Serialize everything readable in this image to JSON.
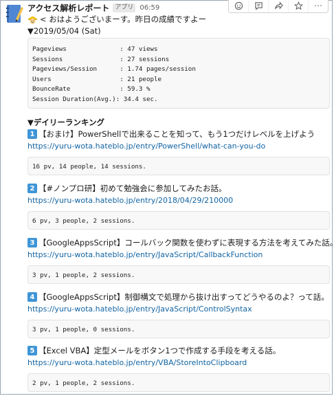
{
  "bot": {
    "name": "アクセス解析レポート",
    "badge": "アプリ",
    "time": "06:59"
  },
  "toolbar": {
    "icons": [
      "emoji-reaction-icon",
      "reply-thread-icon",
      "share-icon",
      "star-icon",
      "more-icon"
    ],
    "more_label": "⋯"
  },
  "greeting": "< おはようございまーす。昨日の成績ですよー",
  "date_line": "▼2019/05/04 (Sat)",
  "stats": [
    "Pageviews              : 47 views",
    "Sessions               : 27 sessions",
    "Pageviews/Session      : 1.74 pages/session",
    "Users                  : 21 people",
    "BounceRate             : 59.3 %",
    "Session Duration(Avg.): 34.4 sec."
  ],
  "ranking_title": "▼デイリーランキング",
  "ranking": [
    {
      "num": "1",
      "title": "【おまけ】PowerShellで出来ることを知って、もう1つだけレベルを上げよう",
      "url": "https://yuru-wota.hateblo.jp/entry/PowerShell/what-can-you-do",
      "stats": "16 pv, 14 people, 14 sessions."
    },
    {
      "num": "2",
      "title": "【#ノンプロ研】初めて勉強会に参加してみたお話。",
      "url": "https://yuru-wota.hateblo.jp/entry/2018/04/29/210000",
      "stats": "6 pv, 3 people, 2 sessions."
    },
    {
      "num": "3",
      "title": "【GoogleAppsScript】コールバック関数を使わずに表現する方法を考えてみた話。",
      "url": "https://yuru-wota.hateblo.jp/entry/JavaScript/CallbackFunction",
      "stats": "3 pv, 1 people, 2 sessions."
    },
    {
      "num": "4",
      "title": "【GoogleAppsScript】制御構文で処理から抜け出すってどうやるのよ？って話。",
      "url": "https://yuru-wota.hateblo.jp/entry/JavaScript/ControlSyntax",
      "stats": "3 pv, 1 people, 0 sessions."
    },
    {
      "num": "5",
      "title": "【Excel VBA】定型メールをボタン1つで作成する手段を考える話。",
      "url": "https://yuru-wota.hateblo.jp/entry/VBA/StoreIntoClipboard",
      "stats": "2 pv, 1 people, 2 sessions."
    }
  ],
  "colors": {
    "link": "#1264a3",
    "number_badge": "#3f95d6",
    "code_bg": "#f8f8f8"
  }
}
